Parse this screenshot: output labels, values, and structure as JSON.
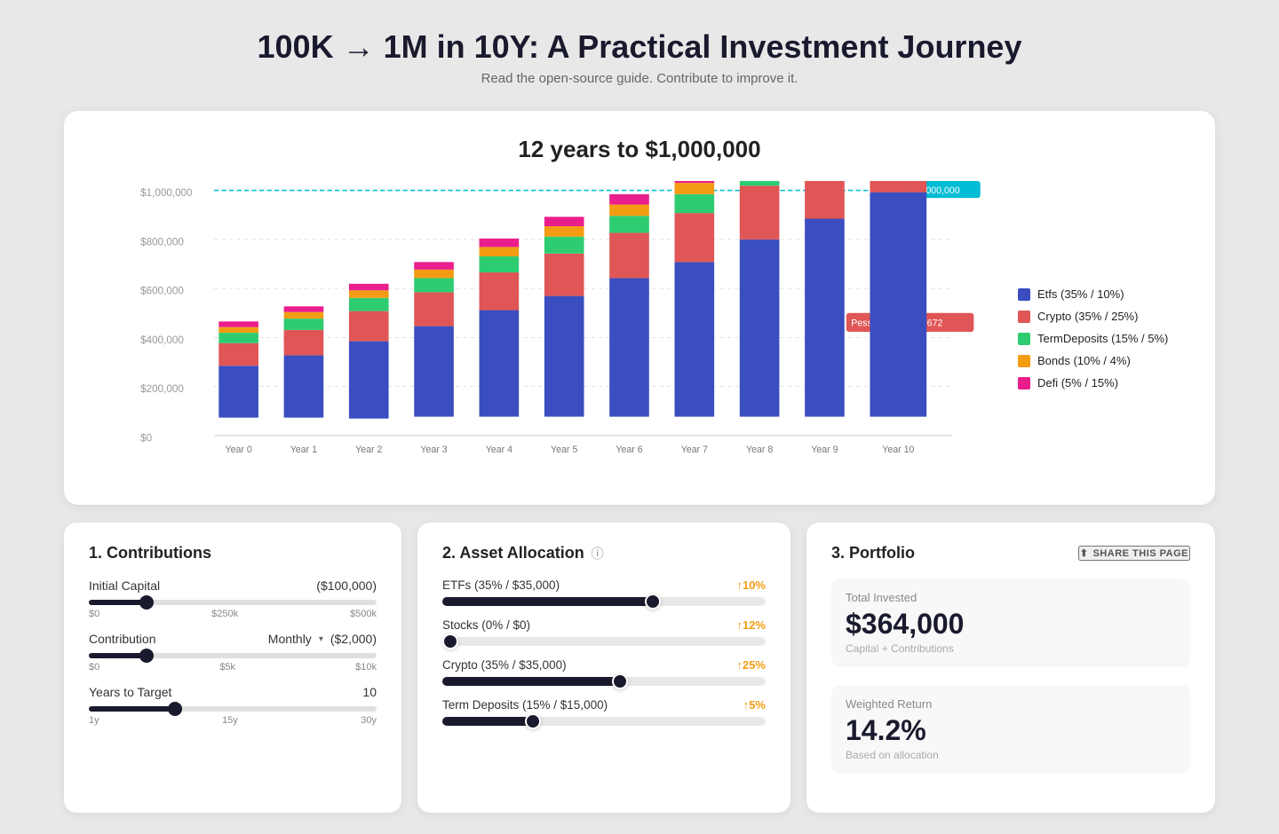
{
  "header": {
    "title": "100K → 1M in 10Y: A Practical Investment Journey",
    "subtitle": "Read the open-source guide. Contribute to improve it."
  },
  "chart": {
    "title": "12 years to $1,000,000",
    "target_label": "Target: $1,000,000",
    "pessimistic_label": "Pessimistic: $200,672",
    "y_labels": [
      "$1,000,000",
      "$800,000",
      "$600,000",
      "$400,000",
      "$200,000",
      "$0"
    ],
    "x_labels": [
      "Year 0",
      "Year 1",
      "Year 2",
      "Year 3",
      "Year 4",
      "Year 5",
      "Year 6",
      "Year 7",
      "Year 8",
      "Year 9",
      "Year 10"
    ],
    "legend": [
      {
        "label": "Etfs (35% / 10%)",
        "color": "#3b4ec0"
      },
      {
        "label": "Crypto (35% / 25%)",
        "color": "#e05555"
      },
      {
        "label": "TermDeposits (15% / 5%)",
        "color": "#2ecc71"
      },
      {
        "label": "Bonds (10% / 4%)",
        "color": "#f39c12"
      },
      {
        "label": "Defi (5% / 15%)",
        "color": "#e91e8c"
      }
    ]
  },
  "contributions": {
    "section_title": "1. Contributions",
    "initial_capital_label": "Initial Capital",
    "initial_capital_value": "($100,000)",
    "slider_initial": {
      "min": "$0",
      "mid": "$250k",
      "max": "$500k",
      "fill_pct": 20
    },
    "contribution_label": "Contribution",
    "contribution_dropdown": "Monthly",
    "contribution_value": "($2,000)",
    "slider_contrib": {
      "min": "$0",
      "mid": "$5k",
      "max": "$10k",
      "fill_pct": 20
    },
    "years_label": "Years to Target",
    "years_value": "10",
    "slider_years": {
      "min": "1y",
      "mid": "15y",
      "max": "30y",
      "fill_pct": 30
    }
  },
  "allocation": {
    "section_title": "2. Asset Allocation",
    "info_icon": "ⓘ",
    "items": [
      {
        "label": "ETFs (35% / $35,000)",
        "return": "↑10%",
        "fill_pct": 65
      },
      {
        "label": "Stocks (0% / $0)",
        "return": "↑12%",
        "fill_pct": 0
      },
      {
        "label": "Crypto (35% / $35,000)",
        "return": "↑25%",
        "fill_pct": 55
      },
      {
        "label": "Term Deposits (15% / $15,000)",
        "return": "↑5%",
        "fill_pct": 28
      }
    ]
  },
  "portfolio": {
    "section_title": "3. Portfolio",
    "share_label": "SHARE THIS PAGE",
    "total_invested_label": "Total Invested",
    "total_invested_value": "$364,000",
    "total_invested_sub": "Capital + Contributions",
    "weighted_return_label": "Weighted Return",
    "weighted_return_value": "14.2%",
    "weighted_return_sub": "Based on allocation"
  }
}
